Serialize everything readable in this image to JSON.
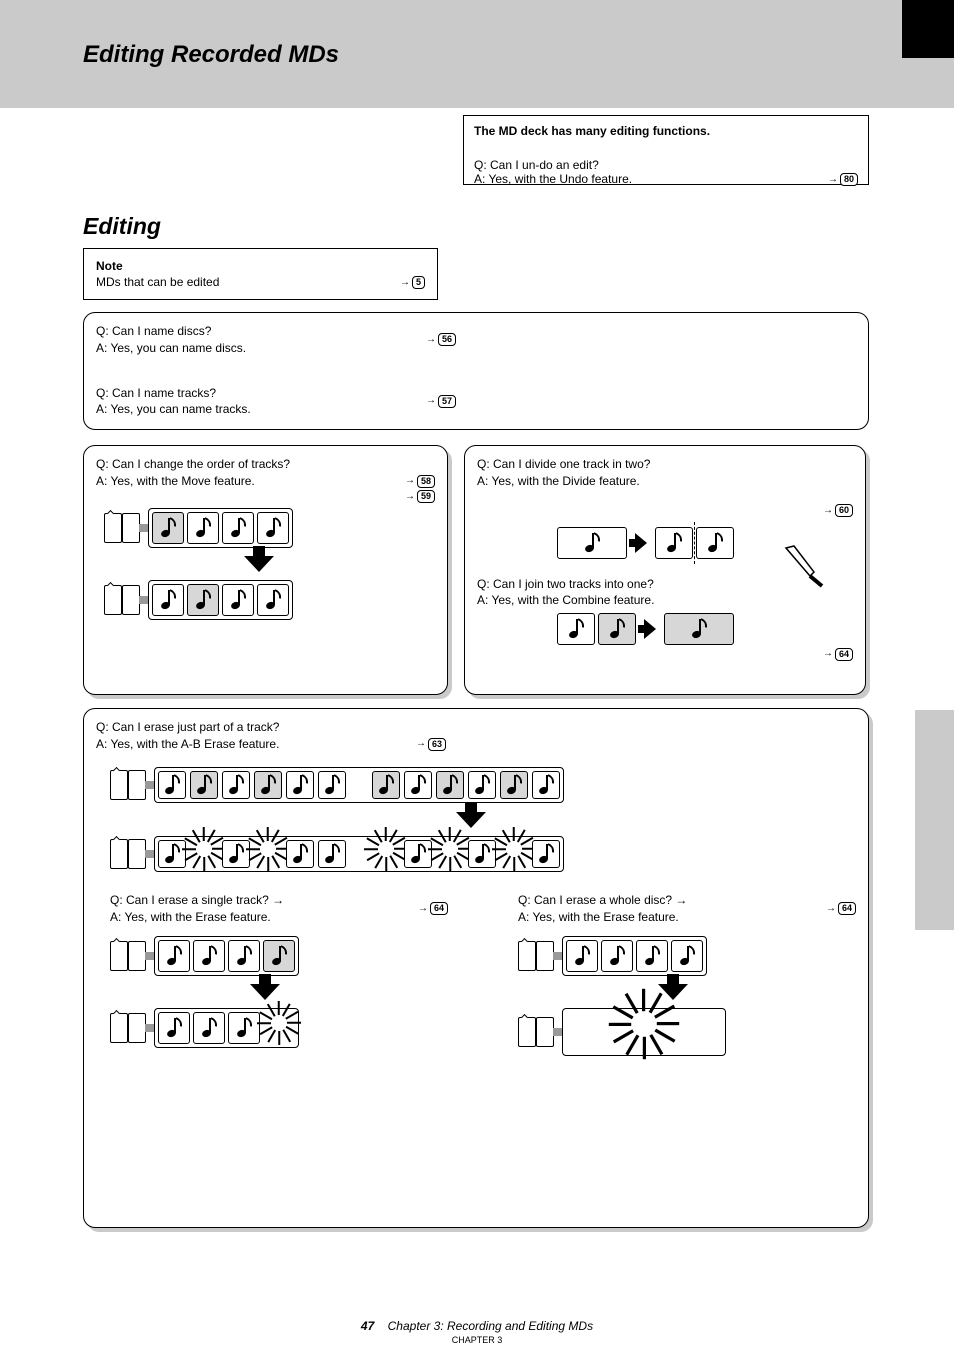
{
  "title": "Editing Recorded MDs",
  "top_box": {
    "heading": "The MD deck has many editing functions.",
    "q": "Q: Can I un-do an edit?",
    "a": "A: Yes, with the Undo feature.",
    "page": "80"
  },
  "section_label": "Editing",
  "note1": {
    "line1": "Note",
    "line2": "MDs that can be edited",
    "page": "5"
  },
  "naming": {
    "q1": "Q: Can I name discs?",
    "page1": "56",
    "q2": "Q: Can I name tracks?",
    "blank": "          →",
    "a1": "A: Yes, you can name discs.",
    "a2": "A: Yes, you can name tracks.",
    "page2": "57"
  },
  "moving": {
    "q": "Q: Can I change the order of tracks?",
    "a": "A: Yes, with the Move feature.",
    "page_a": "58",
    "page_b": "59"
  },
  "dividing": {
    "q1": "Q: Can I divide one track in two?",
    "a1": "A: Yes, with the Divide feature.",
    "page1": "60",
    "q2": "Q: Can I join two tracks into one?",
    "a2": "A: Yes, with the Combine feature.",
    "page2": "64"
  },
  "erase": {
    "heading_q": "Q: Can I erase just part of a track?",
    "heading_a": "A: Yes, with the A-B Erase feature.",
    "heading_page": "63",
    "single_q": "Q: Can I erase a single track? →",
    "single_a": "A: Yes, with the Erase feature.",
    "single_page": "64",
    "all_q": "Q: Can I erase a whole disc? →",
    "all_a": "A: Yes, with the Erase feature.",
    "all_page": "64"
  },
  "footer_page": "47",
  "footer_ch": "Chapter 3: Recording and Editing MDs",
  "subfoot": "CHAPTER 3"
}
